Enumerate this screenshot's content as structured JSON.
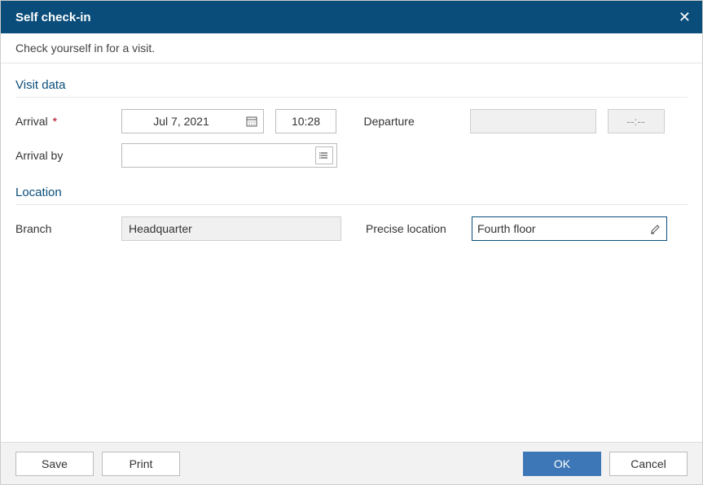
{
  "dialog": {
    "title": "Self check-in",
    "subtitle": "Check yourself in for a visit."
  },
  "sections": {
    "visit": {
      "title": "Visit data",
      "arrival_label": "Arrival",
      "arrival_required_marker": "*",
      "arrival_date": "Jul 7, 2021",
      "arrival_time": "10:28",
      "departure_label": "Departure",
      "departure_date": "",
      "departure_time": "--:--",
      "arrival_by_label": "Arrival by",
      "arrival_by_value": ""
    },
    "location": {
      "title": "Location",
      "branch_label": "Branch",
      "branch_value": "Headquarter",
      "precise_label": "Precise location",
      "precise_value": "Fourth floor"
    }
  },
  "footer": {
    "save": "Save",
    "print": "Print",
    "ok": "OK",
    "cancel": "Cancel"
  }
}
